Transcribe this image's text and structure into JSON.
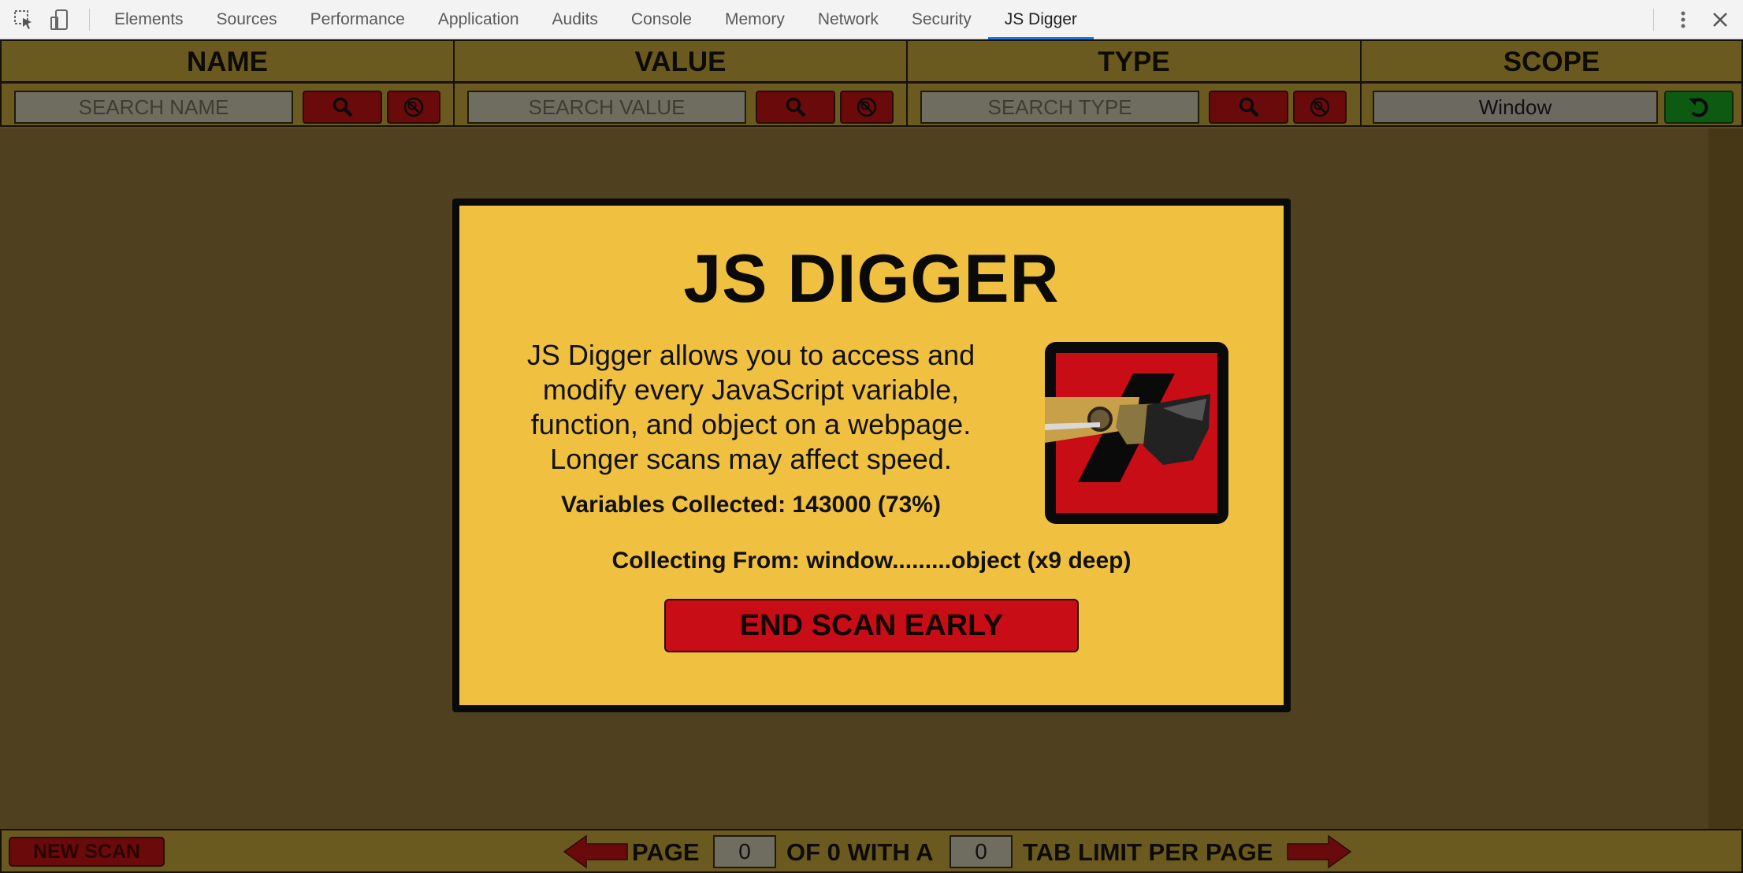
{
  "devtools": {
    "tabs": [
      "Elements",
      "Sources",
      "Performance",
      "Application",
      "Audits",
      "Console",
      "Memory",
      "Network",
      "Security",
      "JS Digger"
    ],
    "active_tab": "JS Digger",
    "icons": [
      "inspect-icon",
      "device-toggle-icon",
      "kebab-menu-icon",
      "close-icon"
    ]
  },
  "columns": {
    "name": {
      "title": "NAME",
      "placeholder": "SEARCH NAME"
    },
    "value": {
      "title": "VALUE",
      "placeholder": "SEARCH VALUE"
    },
    "type": {
      "title": "TYPE",
      "placeholder": "SEARCH TYPE"
    },
    "scope": {
      "title": "SCOPE",
      "value": "Window"
    }
  },
  "modal": {
    "title": "JS DIGGER",
    "description_lines": [
      "JS Digger allows you to access and",
      "modify every JavaScript variable,",
      "function, and object on a webpage.",
      "Longer scans may affect speed."
    ],
    "collected": "Variables Collected: 143000 (73%)",
    "collecting_from": "Collecting From: window.........object (x9 deep)",
    "end_button": "END SCAN EARLY"
  },
  "footer": {
    "new_scan": "NEW SCAN",
    "page_label": "PAGE",
    "page_value": "0",
    "of_label": "OF 0 WITH A",
    "limit_value": "0",
    "limit_label": "TAB LIMIT PER PAGE"
  },
  "colors": {
    "background": "#4f4020",
    "header": "#6b5a20",
    "modal": "#f0c140",
    "danger": "#c90d16",
    "dark_red": "#6b0a0a",
    "green": "#0f5a12",
    "active_tab_underline": "#1a73e8"
  }
}
